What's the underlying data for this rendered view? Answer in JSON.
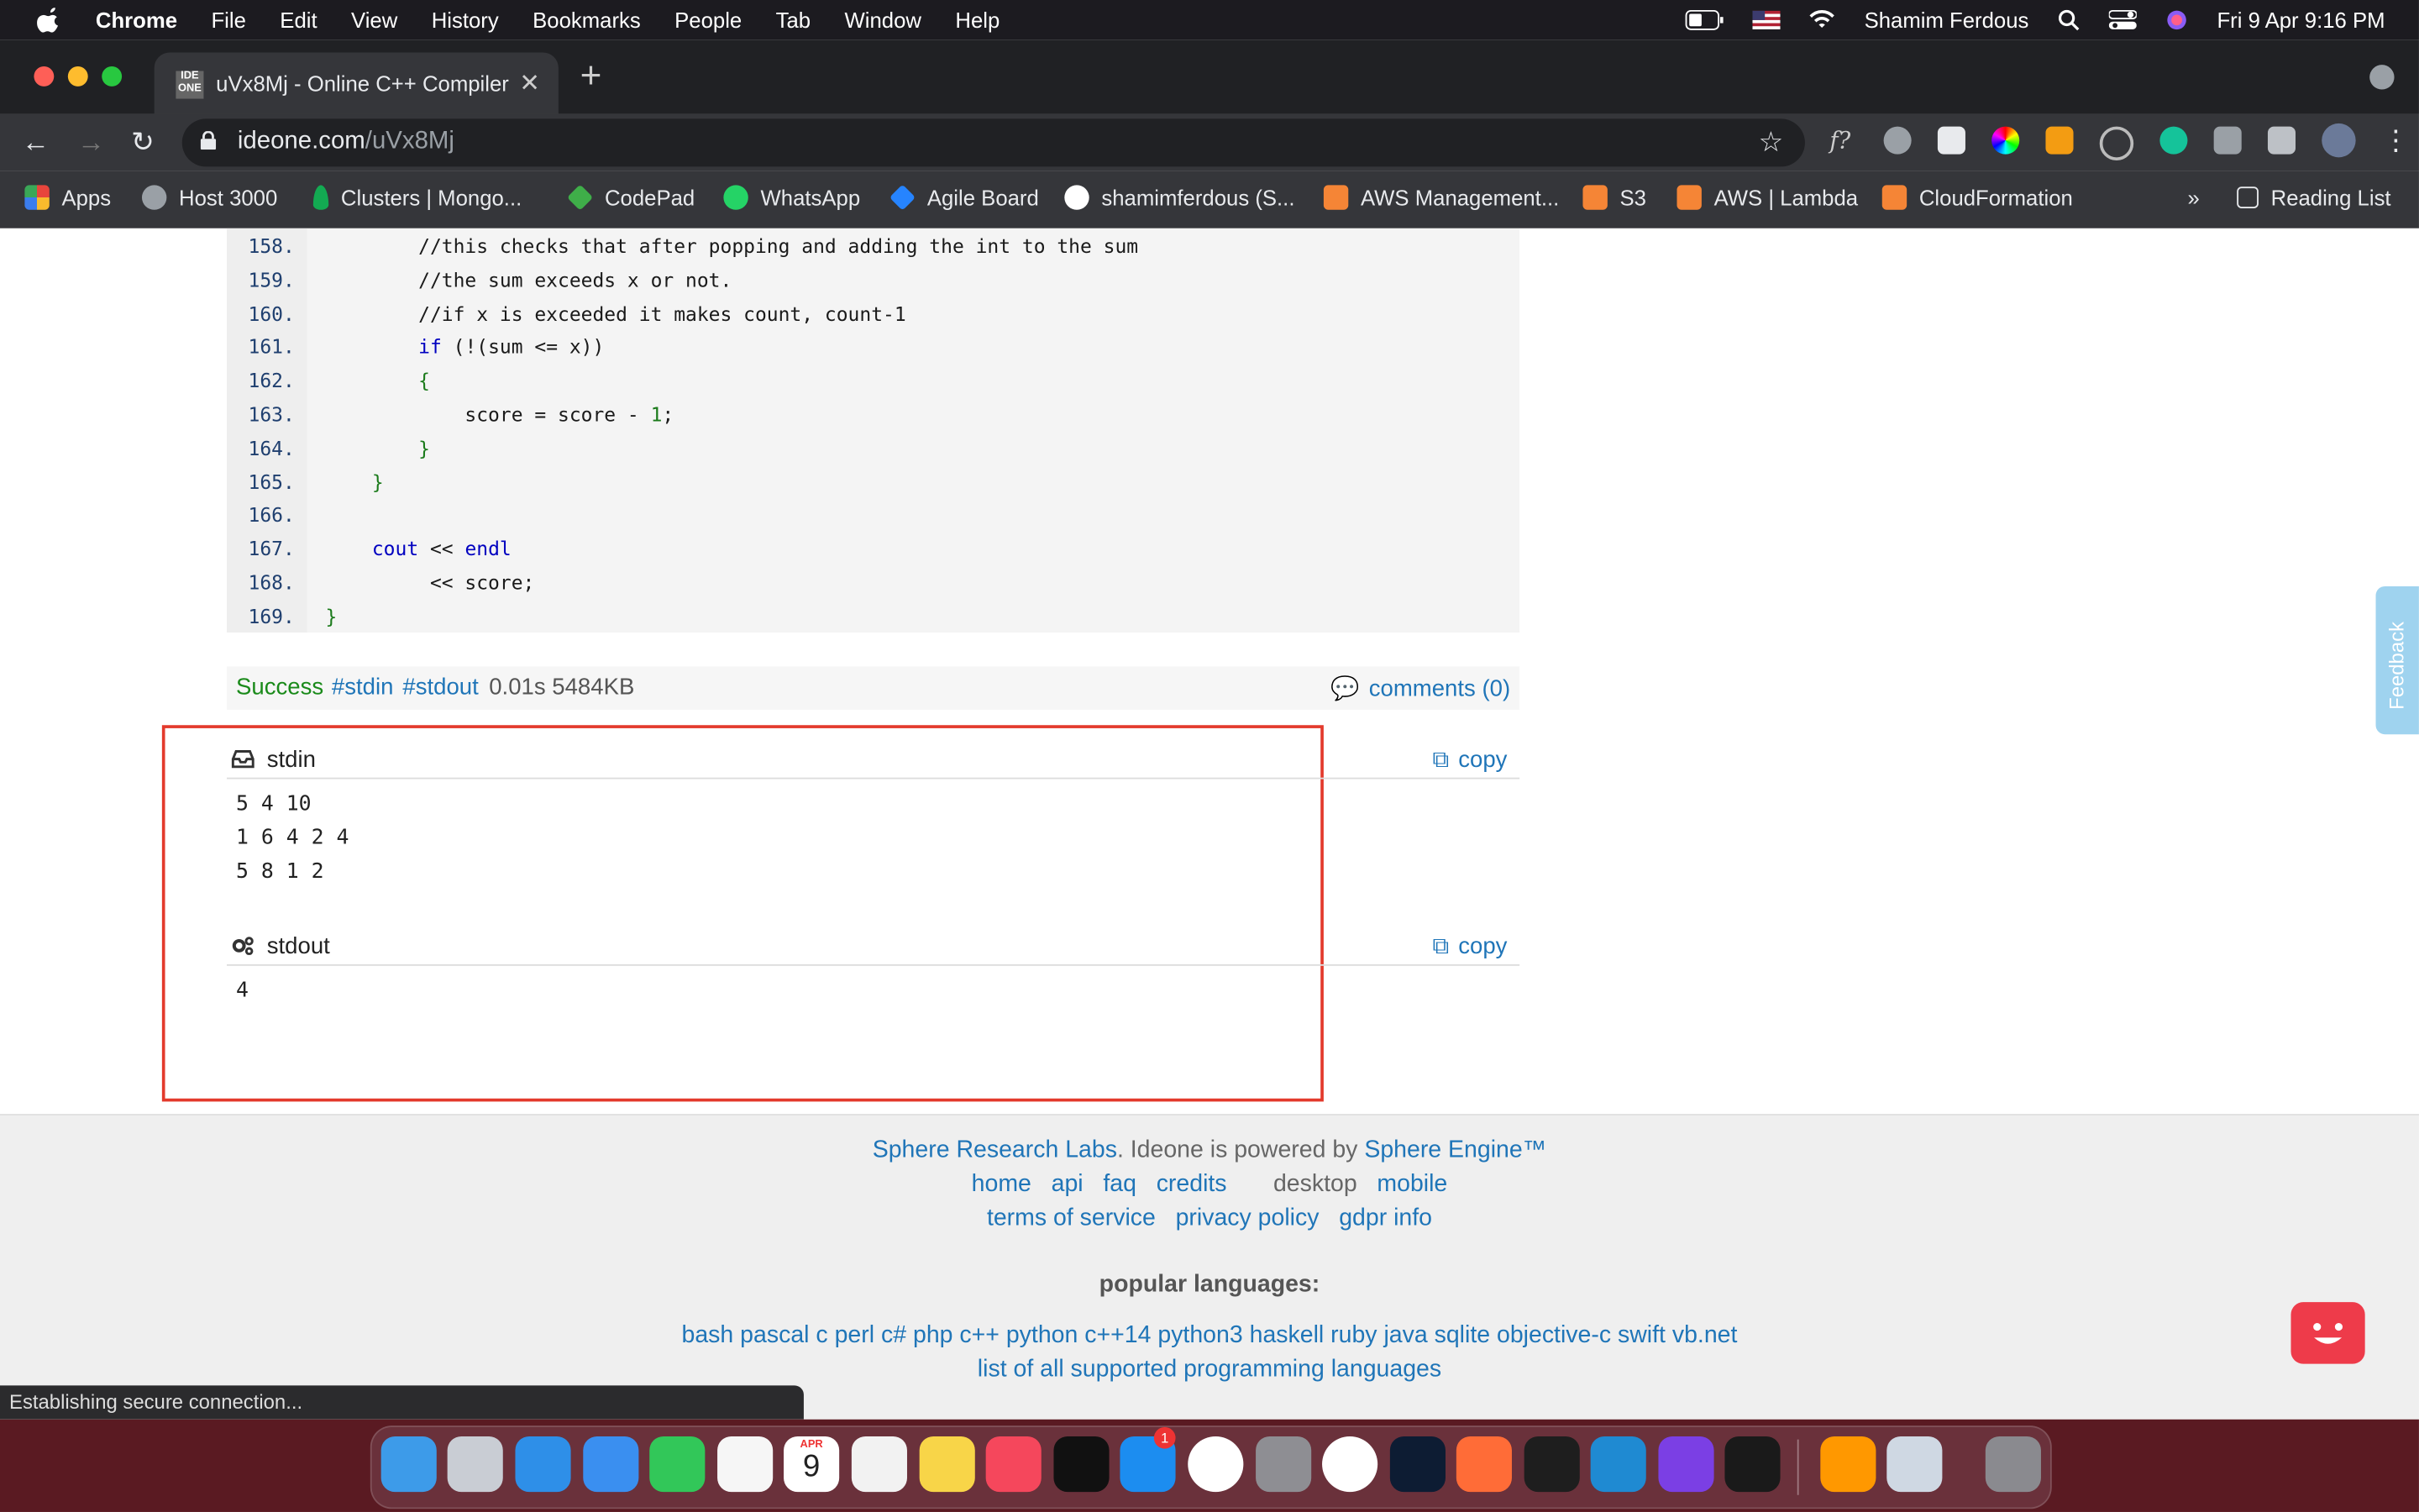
{
  "menubar": {
    "app": "Chrome",
    "items": [
      "File",
      "Edit",
      "View",
      "History",
      "Bookmarks",
      "People",
      "Tab",
      "Window",
      "Help"
    ],
    "user": "Shamim Ferdous",
    "datetime": "Fri 9 Apr  9:16 PM"
  },
  "tab": {
    "favicon": "IDE ONE",
    "title": "uVx8Mj - Online C++ Compiler"
  },
  "omnibox": {
    "domain": "ideone.com",
    "path": "/uVx8Mj"
  },
  "bookmarks": [
    {
      "label": "Apps",
      "icon": "apps-grid-icon",
      "color": "#e8453c"
    },
    {
      "label": "Host 3000",
      "icon": "host-icon",
      "color": "#9aa0a6"
    },
    {
      "label": "Clusters | Mongo...",
      "icon": "mongodb-leaf-icon",
      "color": "#13aa52"
    },
    {
      "label": "CodePad",
      "icon": "codepad-icon",
      "color": "#3fae49"
    },
    {
      "label": "WhatsApp",
      "icon": "whatsapp-icon",
      "color": "#25d366"
    },
    {
      "label": "Agile Board",
      "icon": "jira-icon",
      "color": "#2684ff"
    },
    {
      "label": "shamimferdous (S...",
      "icon": "github-icon",
      "color": "#ffffff"
    },
    {
      "label": "AWS Management...",
      "icon": "aws-icon",
      "color": "#f58536"
    },
    {
      "label": "S3",
      "icon": "aws-icon",
      "color": "#f58536"
    },
    {
      "label": "AWS | Lambda",
      "icon": "lambda-icon",
      "color": "#f58536"
    },
    {
      "label": "CloudFormation",
      "icon": "aws-icon",
      "color": "#f58536"
    }
  ],
  "bookmarks_more": "»",
  "reading_list": "Reading List",
  "code": {
    "lines": [
      {
        "n": "158.",
        "text": "        //this checks that after popping and adding the int to the sum",
        "kind": "comment"
      },
      {
        "n": "159.",
        "text": "        //the sum exceeds x or not.",
        "kind": "comment"
      },
      {
        "n": "160.",
        "text": "        //if x is exceeded it makes count, count-1",
        "kind": "comment"
      },
      {
        "n": "161.",
        "text": "        if (!(sum <= x))",
        "kind": "code"
      },
      {
        "n": "162.",
        "text": "        {",
        "kind": "code"
      },
      {
        "n": "163.",
        "text": "            score = score - 1;",
        "kind": "code"
      },
      {
        "n": "164.",
        "text": "        }",
        "kind": "code"
      },
      {
        "n": "165.",
        "text": "    }",
        "kind": "code"
      },
      {
        "n": "166.",
        "text": "",
        "kind": "code"
      },
      {
        "n": "167.",
        "text": "    cout << endl",
        "kind": "code"
      },
      {
        "n": "168.",
        "text": "         << score;",
        "kind": "code"
      },
      {
        "n": "169.",
        "text": "}",
        "kind": "code"
      }
    ]
  },
  "result": {
    "status": "Success",
    "tag_stdin": "#stdin",
    "tag_stdout": "#stdout",
    "stats": "0.01s 5484KB",
    "comments": "comments (0)"
  },
  "stdin": {
    "label": "stdin",
    "copy": "copy",
    "content": "5 4 10\n1 6 4 2 4\n5 8 1 2"
  },
  "stdout": {
    "label": "stdout",
    "copy": "copy",
    "content": "4"
  },
  "footer": {
    "line1_link1": "Sphere Research Labs",
    "line1_text": ". Ideone is powered by ",
    "line1_link2": "Sphere Engine™",
    "nav": [
      "home",
      "api",
      "faq",
      "credits"
    ],
    "desktop": "desktop",
    "mobile": "mobile",
    "legal": [
      "terms of service",
      "privacy policy",
      "gdpr info"
    ],
    "popular_heading": "popular languages:",
    "languages": [
      "bash",
      "pascal",
      "c",
      "perl",
      "c#",
      "php",
      "c++",
      "python",
      "c++14",
      "python3",
      "haskell",
      "ruby",
      "java",
      "sqlite",
      "objective-c",
      "swift",
      "vb.net"
    ],
    "all_languages": "list of all supported programming languages"
  },
  "feedback_tab": "Feedback",
  "status_bar": "Establishing secure connection...",
  "dock": {
    "apps": [
      {
        "name": "finder",
        "color": "#3d9be9"
      },
      {
        "name": "launchpad",
        "color": "#c9cdd4"
      },
      {
        "name": "safari",
        "color": "#2e8fe8"
      },
      {
        "name": "mail",
        "color": "#3a8ff0"
      },
      {
        "name": "facetime",
        "color": "#32c759"
      },
      {
        "name": "photos",
        "color": "#f6f6f6"
      },
      {
        "name": "calendar",
        "color": "#ffffff"
      },
      {
        "name": "reminders",
        "color": "#f2f2f2"
      },
      {
        "name": "notes",
        "color": "#f8d548"
      },
      {
        "name": "music",
        "color": "#f5475c"
      },
      {
        "name": "apple-tv",
        "color": "#111111"
      },
      {
        "name": "app-store",
        "color": "#1c8df0"
      },
      {
        "name": "mongodb-compass",
        "color": "#ffffff"
      },
      {
        "name": "system-preferences",
        "color": "#8e8e93"
      },
      {
        "name": "chrome",
        "color": "#ffffff"
      },
      {
        "name": "photoshop",
        "color": "#0d1c33"
      },
      {
        "name": "postman",
        "color": "#ff6c37"
      },
      {
        "name": "figma",
        "color": "#1e1e1e"
      },
      {
        "name": "vscode",
        "color": "#1f8ad2"
      },
      {
        "name": "intellij",
        "color": "#7b3fe4"
      },
      {
        "name": "terminal",
        "color": "#1a1a1a"
      },
      {
        "name": "sublime-text",
        "color": "#ff9800"
      },
      {
        "name": "preview",
        "color": "#cfd8e3"
      },
      {
        "name": "trash",
        "color": "#8a8a8f"
      }
    ],
    "calendar_month": "APR",
    "calendar_day": "9",
    "app_store_badge": "1",
    "calendar_index": 6,
    "app_store_index": 11
  },
  "colors": {
    "highlight_box": "#e33a2c",
    "link": "#1f75b8",
    "success": "#1a8a1a"
  }
}
